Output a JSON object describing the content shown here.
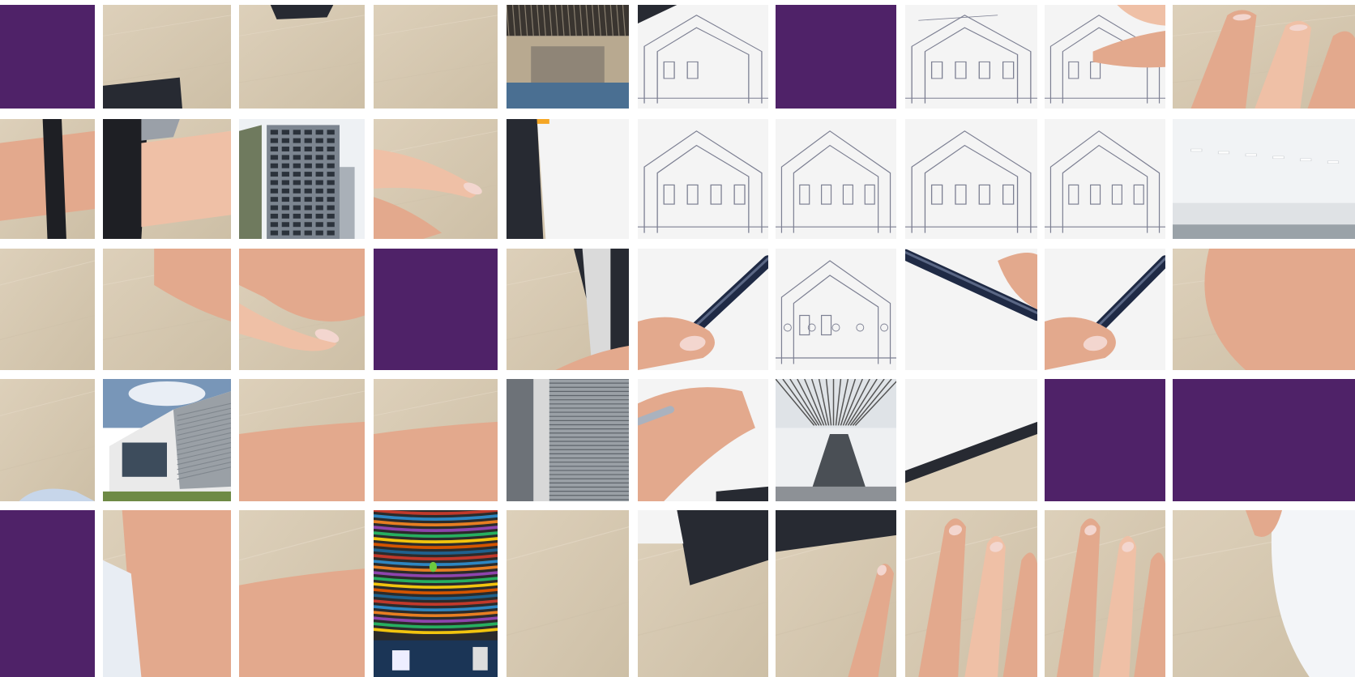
{
  "mosaic": {
    "columns": 10,
    "rows": 5,
    "colors": {
      "purple": "#4f2268",
      "desk": "#ddd0ba",
      "desk_dark": "#cdbfa6",
      "paper": "#f4f4f4",
      "skin": "#e3a98d",
      "skin_light": "#efc0a6",
      "nail": "#f3d6cf",
      "clipboard": "#272a32",
      "blueprint_line": "#7c7f92",
      "pen": "#1f2a45",
      "sky": "#7896b8",
      "building_grey": "#9aa0a6",
      "ceiling_grey": "#c9cdd1",
      "floor_blue": "#4a6f92"
    },
    "tiles": [
      [
        "purple",
        "desk-watch-edge",
        "desk-clipboard-corner",
        "desk",
        "building-lobby",
        "blueprint-clipboard-edge",
        "purple",
        "blueprint-title",
        "blueprint-fingers",
        "fingers"
      ],
      [
        "wrist-watch",
        "watch-desk",
        "building-tower",
        "desk-fingertips",
        "clipboard-blueprint",
        "blueprint-house",
        "blueprint-house",
        "blueprint-house",
        "blueprint-house",
        "office-interior"
      ],
      [
        "desk",
        "hand-desk",
        "hand-fingertips",
        "purple",
        "clipboard-edge",
        "pen-hand",
        "blueprint-lower",
        "pen-paper",
        "pen-hand",
        "hand-back"
      ],
      [
        "desk-sleeve",
        "building-facade",
        "arm",
        "arm",
        "building-louvre",
        "hand-pen-lower",
        "building-escalator",
        "clipboard-corner",
        "purple",
        "purple"
      ],
      [
        "purple",
        "arm-sleeve",
        "arm",
        "building-colorful-ceiling",
        "desk",
        "clipboard-bottom",
        "clipboard-fingers",
        "fingers",
        "fingers",
        "sleeve-corner"
      ]
    ]
  }
}
